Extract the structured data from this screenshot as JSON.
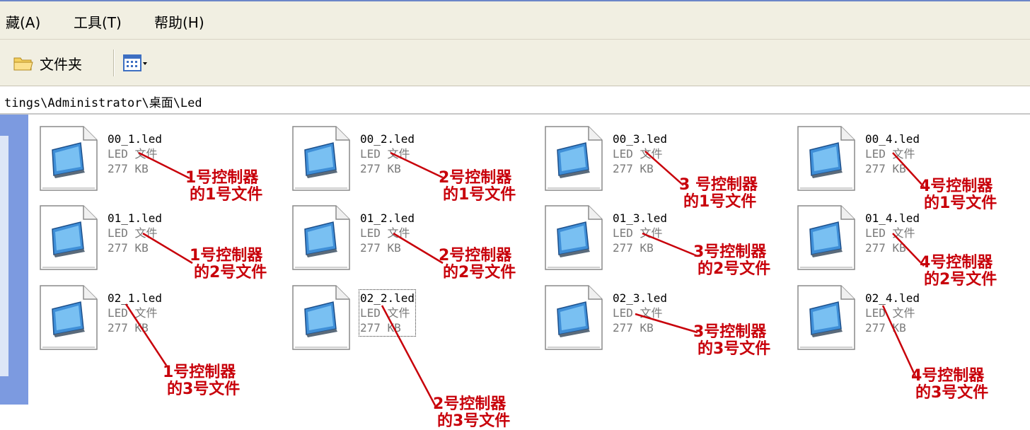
{
  "menu": {
    "favorites": "藏(A)",
    "tools": "工具(T)",
    "help": "帮助(H)"
  },
  "toolbar": {
    "folders_label": "文件夹",
    "views_icon": "views-grid-icon"
  },
  "address": {
    "path": "tings\\Administrator\\桌面\\Led"
  },
  "files": [
    {
      "name": "00_1.led",
      "type": "LED 文件",
      "size": "277 KB"
    },
    {
      "name": "00_2.led",
      "type": "LED 文件",
      "size": "277 KB"
    },
    {
      "name": "00_3.led",
      "type": "LED 文件",
      "size": "277 KB"
    },
    {
      "name": "00_4.led",
      "type": "LED 文件",
      "size": "277 KB"
    },
    {
      "name": "01_1.led",
      "type": "LED 文件",
      "size": "277 KB"
    },
    {
      "name": "01_2.led",
      "type": "LED 文件",
      "size": "277 KB"
    },
    {
      "name": "01_3.led",
      "type": "LED 文件",
      "size": "277 KB"
    },
    {
      "name": "01_4.led",
      "type": "LED 文件",
      "size": "277 KB"
    },
    {
      "name": "02_1.led",
      "type": "LED 文件",
      "size": "277 KB"
    },
    {
      "name": "02_2.led",
      "type": "LED 文件",
      "size": "277 KB"
    },
    {
      "name": "02_3.led",
      "type": "LED 文件",
      "size": "277 KB"
    },
    {
      "name": "02_4.led",
      "type": "LED 文件",
      "size": "277 KB"
    }
  ],
  "annotations": [
    {
      "line1": "1号控制器",
      "line2": "的1号文件"
    },
    {
      "line1": "2号控制器",
      "line2": "的1号文件"
    },
    {
      "line1": "3 号控制器",
      "line2": "的1号文件"
    },
    {
      "line1": "4号控制器",
      "line2": "的1号文件"
    },
    {
      "line1": "1号控制器",
      "line2": "的2号文件"
    },
    {
      "line1": "2号控制器",
      "line2": "的2号文件"
    },
    {
      "line1": "3号控制器",
      "line2": "的2号文件"
    },
    {
      "line1": "4号控制器",
      "line2": "的2号文件"
    },
    {
      "line1": "1号控制器",
      "line2": "的3号文件"
    },
    {
      "line1": "2号控制器",
      "line2": "的3号文件"
    },
    {
      "line1": "3号控制器",
      "line2": "的3号文件"
    },
    {
      "line1": "4号控制器",
      "line2": "的3号文件"
    }
  ],
  "colors": {
    "annotation": "#c8000a",
    "sidebar": "#7c9ae0"
  }
}
